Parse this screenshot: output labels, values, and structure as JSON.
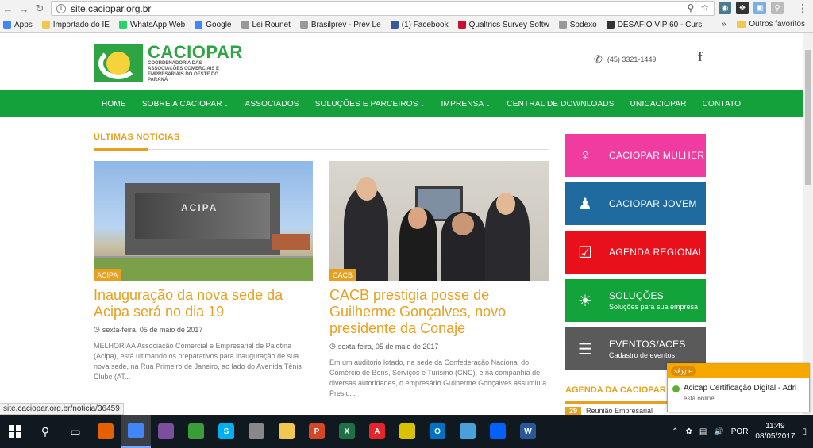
{
  "browser": {
    "url": "site.caciopar.org.br",
    "bookmarks": [
      {
        "label": "Apps",
        "icon": "apps-grid-icon",
        "color": "#4285f4"
      },
      {
        "label": "Importado do IE",
        "icon": "folder-icon",
        "color": "#f0c850"
      },
      {
        "label": "WhatsApp Web",
        "icon": "whatsapp-icon",
        "color": "#25d366"
      },
      {
        "label": "Google",
        "icon": "google-icon",
        "color": "#4285f4"
      },
      {
        "label": "Lei Rounet",
        "icon": "page-icon",
        "color": "#999999"
      },
      {
        "label": "Brasilprev - Prev Le",
        "icon": "page-icon",
        "color": "#999999"
      },
      {
        "label": "(1) Facebook",
        "icon": "facebook-icon",
        "color": "#3b5998"
      },
      {
        "label": "Qualtrics Survey Softw",
        "icon": "qualtrics-icon",
        "color": "#c8102e"
      },
      {
        "label": "Sodexo",
        "icon": "page-icon",
        "color": "#999999"
      },
      {
        "label": "DESAFIO VIP 60 - Curs",
        "icon": "desafio-icon",
        "color": "#333333"
      }
    ],
    "bookmarks_overflow": "»",
    "other_bookmarks": "Outros favoritos",
    "status_url": "site.caciopar.org.br/noticia/36459"
  },
  "site": {
    "logo_title": "CACIOPAR",
    "logo_subtitle": "COORDENADORIA DAS ASSOCIAÇÕES COMERCIAIS E EMPRESARIAIS DO OESTE DO PARANÁ",
    "phone": "(45) 3321-1449",
    "facebook_glyph": "f",
    "nav": [
      {
        "label": "HOME",
        "dropdown": false
      },
      {
        "label": "SOBRE A CACIOPAR",
        "dropdown": true
      },
      {
        "label": "ASSOCIADOS",
        "dropdown": false
      },
      {
        "label": "SOLUÇÕES E PARCEIROS",
        "dropdown": true
      },
      {
        "label": "IMPRENSA",
        "dropdown": true
      },
      {
        "label": "CENTRAL DE DOWNLOADS",
        "dropdown": false
      },
      {
        "label": "UNICACIOPAR",
        "dropdown": false
      },
      {
        "label": "CONTATO",
        "dropdown": false
      }
    ],
    "section_title": "ÚLTIMAS NOTÍCIAS",
    "news": [
      {
        "tag": "ACIPA",
        "image_logo": "ACIPA",
        "title": "Inauguração da nova sede da Acipa será no dia 19",
        "date": "sexta-feira, 05 de maio de 2017",
        "excerpt": "MELHORIAA Associação Comercial e Empresarial de Palotina (Acipa), está ultimando os preparativos para inauguração de sua nova sede, na Rua Primeiro de Janeiro, ao lado do Avenida Tênis Clube (AT..."
      },
      {
        "tag": "CACB",
        "title": "CACB prestigia posse de Guilherme Gonçalves, novo presidente da Conaje",
        "date": "sexta-feira, 05 de maio de 2017",
        "excerpt": "Em um auditório lotado, na sede da Confederação Nacional do Comércio de Bens, Serviços e Turismo (CNC), e na companhia de diversas autoridades, o empresário Guilherme Gonçalves assumiu a Presid..."
      }
    ],
    "sidebar": [
      {
        "label": "CACIOPAR MULHER",
        "sub": "",
        "color": "#f03ca0",
        "icon": "woman-icon"
      },
      {
        "label": "CACIOPAR JOVEM",
        "sub": "",
        "color": "#1f6ba0",
        "icon": "person-icon"
      },
      {
        "label": "AGENDA REGIONAL",
        "sub": "",
        "color": "#e8101a",
        "icon": "calendar-check-icon"
      },
      {
        "label": "SOLUÇÕES",
        "sub": "Soluções para sua empresa",
        "color": "#12a33a",
        "icon": "lightbulb-icon"
      },
      {
        "label": "EVENTOS/ACES",
        "sub": "Cadastro de eventos",
        "color": "#5a5a5a",
        "icon": "server-list-icon"
      }
    ],
    "agenda_title": "AGENDA DA CACIOPAR",
    "agenda_item": {
      "day": "29",
      "text": "Reunião Empresarial"
    }
  },
  "skype": {
    "brand": "skype",
    "contact": "Acicap Certificação Digital - Adri",
    "status": "está online"
  },
  "taskbar": {
    "language": "POR",
    "time": "11:49",
    "date": "08/05/2017",
    "apps": [
      {
        "name": "firefox",
        "label": "",
        "color": "#e66000"
      },
      {
        "name": "chrome",
        "label": "",
        "color": "#4285f4",
        "active": true
      },
      {
        "name": "app-purple",
        "label": "",
        "color": "#7b4f9d"
      },
      {
        "name": "app-green-leaf",
        "label": "",
        "color": "#3a9d3a"
      },
      {
        "name": "skype",
        "label": "S",
        "color": "#00aff0"
      },
      {
        "name": "app-tools",
        "label": "",
        "color": "#888888"
      },
      {
        "name": "file-explorer",
        "label": "",
        "color": "#f0c850"
      },
      {
        "name": "powerpoint",
        "label": "P",
        "color": "#d24726"
      },
      {
        "name": "excel",
        "label": "X",
        "color": "#1e7145"
      },
      {
        "name": "acrobat",
        "label": "A",
        "color": "#e5252a"
      },
      {
        "name": "app-arrow",
        "label": "",
        "color": "#d7c100"
      },
      {
        "name": "outlook",
        "label": "O",
        "color": "#0072c6"
      },
      {
        "name": "app-blue",
        "label": "",
        "color": "#4aa0d8"
      },
      {
        "name": "dropbox",
        "label": "",
        "color": "#0061fe"
      },
      {
        "name": "word",
        "label": "W",
        "color": "#2b579a"
      }
    ]
  }
}
